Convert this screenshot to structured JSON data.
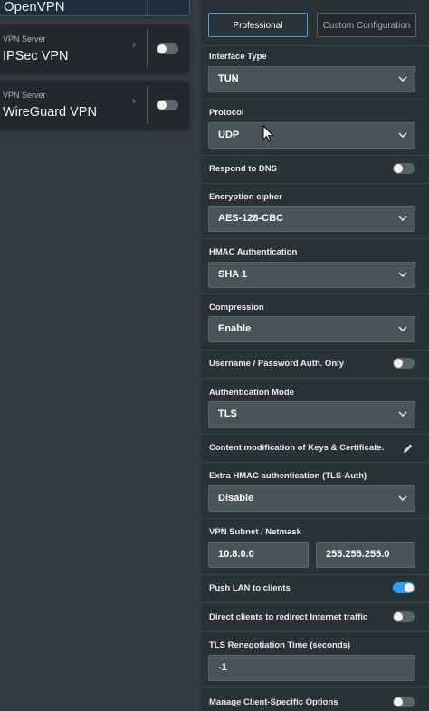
{
  "left": {
    "top_card": {
      "name": "OpenVPN"
    },
    "cards": [
      {
        "subtitle": "VPN Server",
        "title": "IPSec VPN",
        "enabled": false
      },
      {
        "subtitle": "VPN Server",
        "title": "WireGuard VPN",
        "enabled": false
      }
    ]
  },
  "panel": {
    "mode_buttons": {
      "professional": "Professional",
      "custom": "Custom Configuration",
      "active": "professional"
    },
    "interface_type": {
      "label": "Interface Type",
      "value": "TUN"
    },
    "protocol": {
      "label": "Protocol",
      "value": "UDP"
    },
    "respond_dns": {
      "label": "Respond to DNS",
      "enabled": false
    },
    "cipher": {
      "label": "Encryption cipher",
      "value": "AES-128-CBC"
    },
    "hmac": {
      "label": "HMAC Authentication",
      "value": "SHA 1"
    },
    "compression": {
      "label": "Compression",
      "value": "Enable"
    },
    "user_pass_only": {
      "label": "Username / Password Auth. Only",
      "enabled": false
    },
    "auth_mode": {
      "label": "Authentication Mode",
      "value": "TLS"
    },
    "content_mod": {
      "label": "Content modification of Keys & Certificate."
    },
    "tls_auth": {
      "label": "Extra HMAC authentication (TLS-Auth)",
      "value": "Disable"
    },
    "subnet": {
      "label": "VPN Subnet / Netmask",
      "subnet": "10.8.0.0",
      "netmask": "255.255.255.0"
    },
    "push_lan": {
      "label": "Push LAN to clients",
      "enabled": true
    },
    "redirect": {
      "label": "Direct clients to redirect Internet traffic",
      "enabled": false
    },
    "tls_reneg": {
      "label": "TLS Renegotiation Time (seconds)",
      "value": "-1"
    },
    "client_specific": {
      "label": "Manage Client-Specific Options",
      "enabled": false
    }
  },
  "colors": {
    "accent": "#2f9ee8",
    "panel_bg": "#2b3236",
    "field_bg": "#4a5358"
  }
}
